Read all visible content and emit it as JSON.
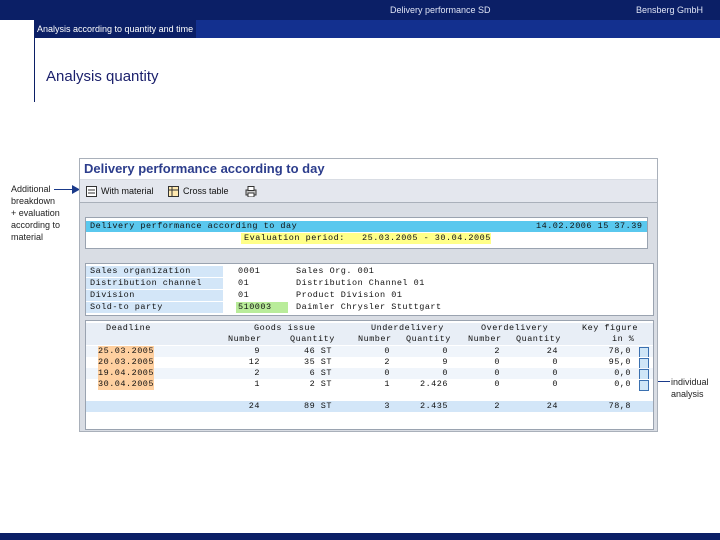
{
  "slide": {
    "header_center": "Delivery performance SD",
    "header_right": "Bensberg GmbH",
    "subtitle": "Analysis according to quantity and time",
    "heading": "Analysis quantity",
    "callout_left": [
      "Additional",
      "breakdown",
      "+ evaluation",
      "according to",
      "material"
    ],
    "callout_right": [
      "individual",
      "analysis"
    ]
  },
  "sap": {
    "title": "Delivery performance according to day",
    "toolbar": {
      "with_material": "With material",
      "cross_table": "Cross table",
      "print_icon": "printer-icon"
    },
    "header": {
      "report_title": "Delivery performance according to day",
      "timestamp": "14.02.2006 15 37.39",
      "eval_label": "Evaluation period:",
      "eval_value": "25.03.2005 - 30.04.2005"
    },
    "selection": [
      {
        "label": "Sales organization",
        "value": "0001",
        "text": "Sales Org. 001"
      },
      {
        "label": "Distribution channel",
        "value": "01",
        "text": "Distribution Channel 01"
      },
      {
        "label": "Division",
        "value": "01",
        "text": "Product Division 01"
      },
      {
        "label": "Sold-to party",
        "value": "510003",
        "text": "Daimler Chrysler Stuttgart"
      }
    ],
    "table": {
      "col_deadline": "Deadline",
      "col_goods_issue": "Goods issue",
      "col_underdelivery": "Underdelivery",
      "col_overdelivery": "Overdelivery",
      "col_key_figure": "Key figure",
      "sub_number": "Number",
      "sub_quantity": "Quantity",
      "sub_in_pct": "in %",
      "rows": [
        {
          "date": "25.03.2005",
          "gi_num": "9",
          "gi_qty": "46 ST",
          "ud_num": "0",
          "ud_qty": "0",
          "od_num": "2",
          "od_qty": "24",
          "kf": "78,0"
        },
        {
          "date": "20.03.2005",
          "gi_num": "12",
          "gi_qty": "35 ST",
          "ud_num": "2",
          "ud_qty": "9",
          "od_num": "0",
          "od_qty": "0",
          "kf": "95,0"
        },
        {
          "date": "19.04.2005",
          "gi_num": "2",
          "gi_qty": "6 ST",
          "ud_num": "0",
          "ud_qty": "0",
          "od_num": "0",
          "od_qty": "0",
          "kf": "0,0"
        },
        {
          "date": "30.04.2005",
          "gi_num": "1",
          "gi_qty": "2 ST",
          "ud_num": "1",
          "ud_qty": "2.426",
          "od_num": "0",
          "od_qty": "0",
          "kf": "0,0"
        }
      ],
      "total": {
        "gi_num": "24",
        "gi_qty": "89 ST",
        "ud_num": "3",
        "ud_qty": "2.435",
        "od_num": "2",
        "od_qty": "24",
        "kf": "78,8"
      }
    }
  }
}
